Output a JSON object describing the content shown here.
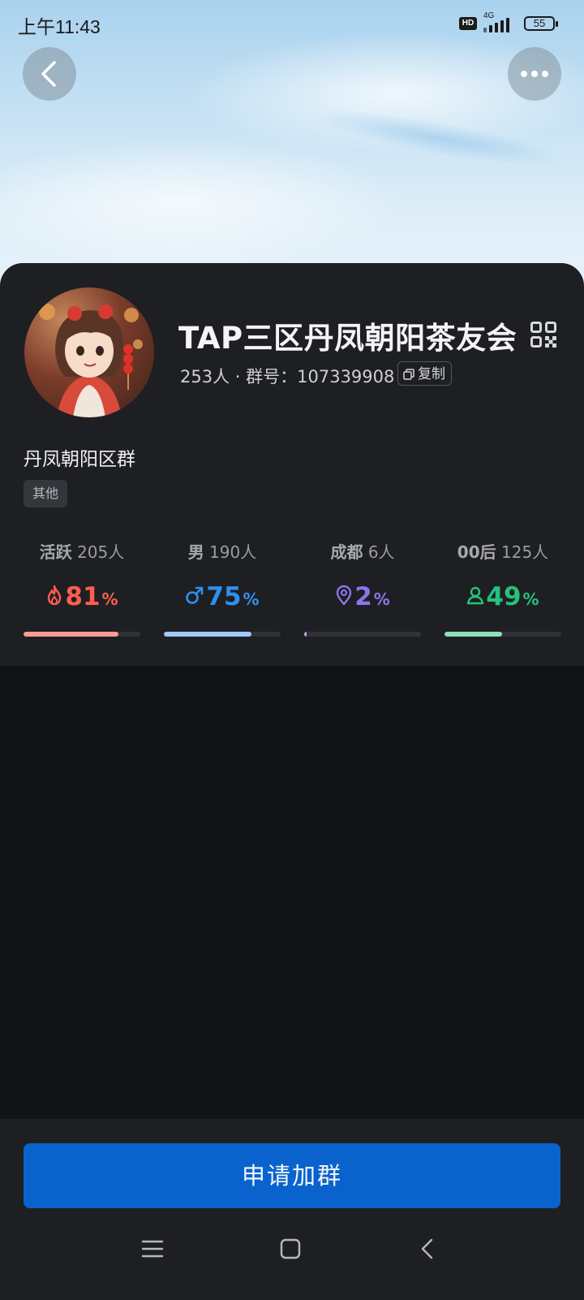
{
  "status_bar": {
    "time": "上午11:43",
    "hd_badge": "HD",
    "network": "4G",
    "battery": "55"
  },
  "header": {
    "back_icon": "chevron-left-icon",
    "more_icon": "more-horizontal-icon"
  },
  "group": {
    "name": "TAP三区丹凤朝阳茶友会",
    "member_count": "253人",
    "separator": " · ",
    "id_label": "群号：",
    "id_value": "107339908",
    "copy_label": "复制",
    "description": "丹凤朝阳区群",
    "tag": "其他"
  },
  "stats": [
    {
      "title": "活跃",
      "value": "205人",
      "percent": "81",
      "percent_sign": "%",
      "icon": "flame-icon",
      "color": "#ff5d4e",
      "bar_color": "#ff9a94",
      "fill": 0.81
    },
    {
      "title": "男",
      "value": "190人",
      "percent": "75",
      "percent_sign": "%",
      "icon": "male-icon",
      "color": "#2f8ff0",
      "bar_color": "#9fc8ff",
      "fill": 0.75
    },
    {
      "title": "成都",
      "value": "6人",
      "percent": "2",
      "percent_sign": "%",
      "icon": "location-pin-icon",
      "color": "#8b74ec",
      "bar_color": "#b7a9f6",
      "fill": 0.02
    },
    {
      "title": "00后",
      "value": "125人",
      "percent": "49",
      "percent_sign": "%",
      "icon": "person-icon",
      "color": "#24c27c",
      "bar_color": "#8fe0b6",
      "fill": 0.49
    }
  ],
  "footer": {
    "join_label": "申请加群"
  },
  "nav": {
    "menu_icon": "menu-icon",
    "home_icon": "home-square-icon",
    "back_icon": "back-arrow-icon"
  }
}
